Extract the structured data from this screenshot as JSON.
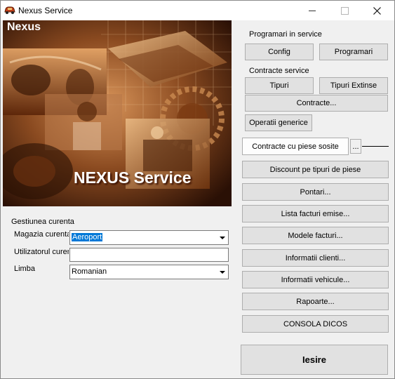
{
  "window": {
    "title": "Nexus Service"
  },
  "banner": {
    "corner_label": "Nexus",
    "title": "NEXUS Service"
  },
  "programari": {
    "header": "Programari in service",
    "config_label": "Config",
    "programari_label": "Programari"
  },
  "contracte": {
    "header": "Contracte service",
    "tipuri_label": "Tipuri",
    "tipuri_extinse_label": "Tipuri Extinse",
    "contracte_label": "Contracte..."
  },
  "actions": {
    "operatii_generice": "Operatii generice",
    "contracte_piese_sosite": "Contracte cu piese sosite",
    "dots": "...",
    "discount": "Discount pe tipuri de piese",
    "pontari": "Pontari...",
    "lista_facturi": "Lista facturi emise...",
    "modele_facturi": "Modele facturi...",
    "informatii_clienti": "Informatii clienti...",
    "informatii_vehicule": "Informatii vehicule...",
    "rapoarte": "Rapoarte...",
    "consola": "CONSOLA DICOS",
    "iesire": "Iesire"
  },
  "gestiune": {
    "header": "Gestiunea curenta",
    "magazia_label": "Magazia curenta",
    "magazia_value": "Aeroport",
    "utilizator_label": "Utilizatorul curent",
    "utilizator_value": "",
    "limba_label": "Limba",
    "limba_value": "Romanian"
  }
}
